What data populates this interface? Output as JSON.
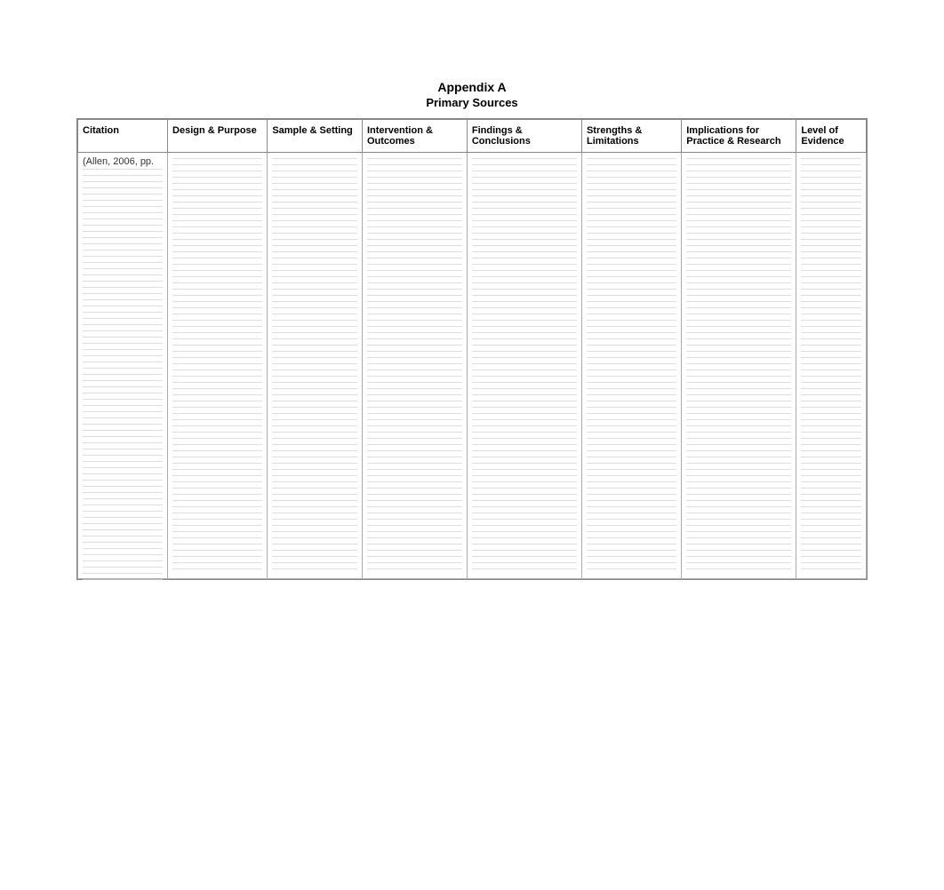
{
  "appendix": {
    "title": "Appendix A",
    "subtitle": "Primary Sources"
  },
  "table": {
    "headers": [
      {
        "id": "citation",
        "label": "Citation"
      },
      {
        "id": "design",
        "label": "Design & Purpose"
      },
      {
        "id": "sample",
        "label": "Sample & Setting"
      },
      {
        "id": "intervention",
        "label": "Intervention & Outcomes"
      },
      {
        "id": "findings",
        "label": "Findings & Conclusions"
      },
      {
        "id": "strengths",
        "label": "Strengths & Limitations"
      },
      {
        "id": "implications",
        "label": "Implications for Practice & Research"
      },
      {
        "id": "level",
        "label": "Level of Evidence"
      }
    ],
    "rows": [
      {
        "citation": "(Allen, 2006, pp.",
        "design": "",
        "sample": "",
        "intervention": "",
        "findings": "",
        "strengths": "",
        "implications": "",
        "level": ""
      }
    ]
  }
}
